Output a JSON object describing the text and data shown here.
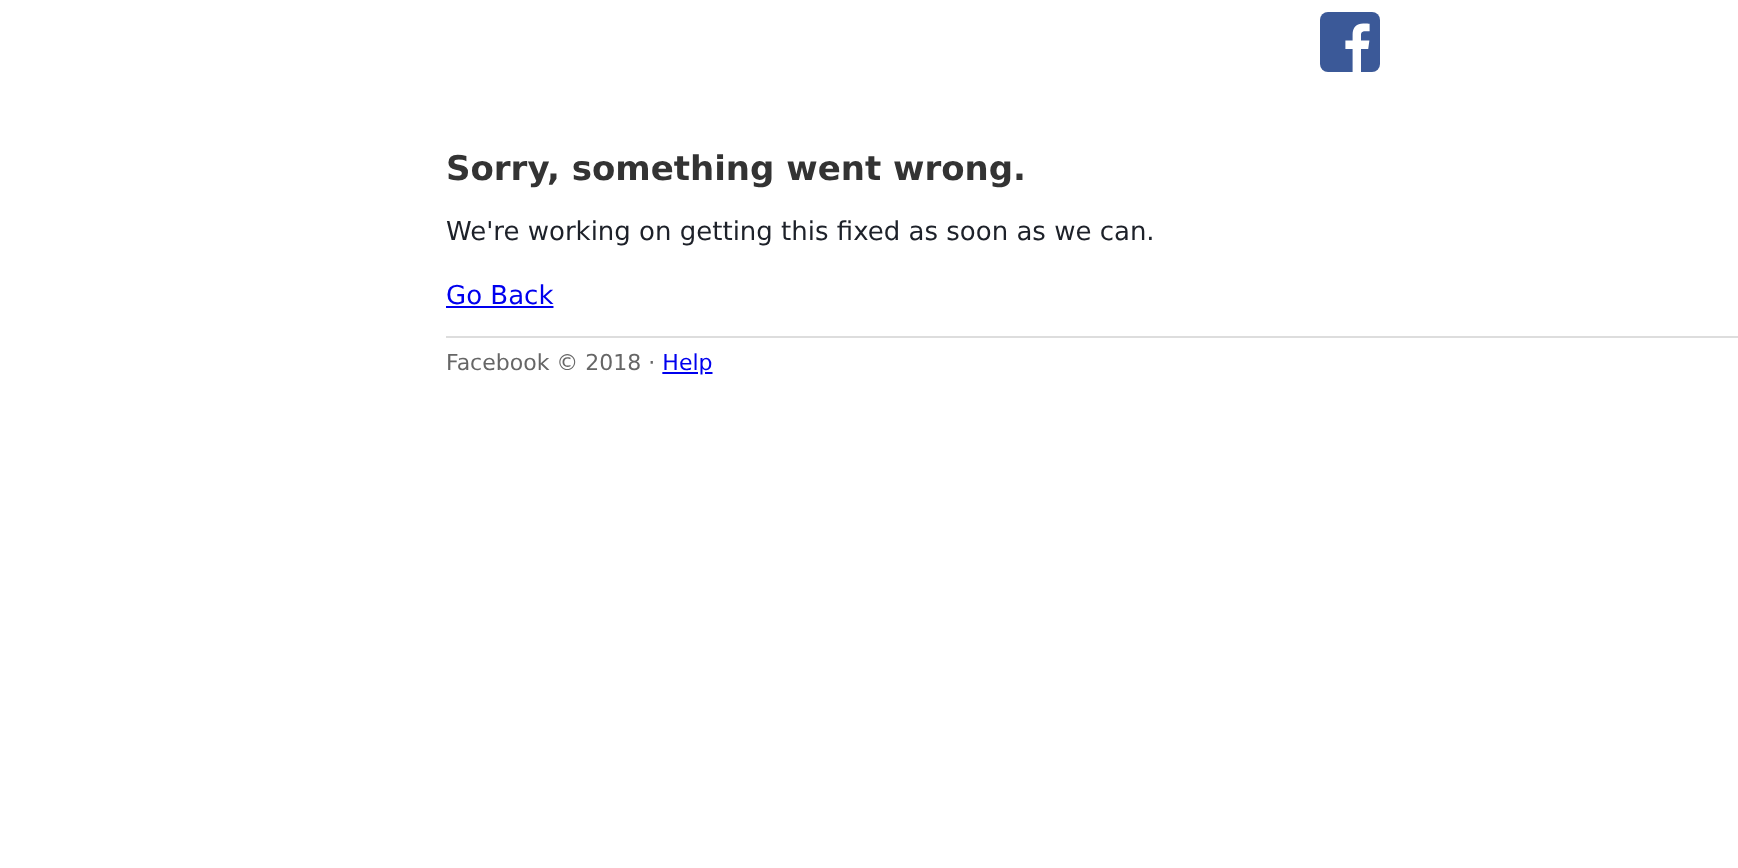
{
  "heading": "Sorry, something went wrong.",
  "message": "We're working on getting this fixed as soon as we can.",
  "back_link": "Go Back",
  "footer": {
    "text": "Facebook © 2018 · ",
    "link": "Help"
  }
}
